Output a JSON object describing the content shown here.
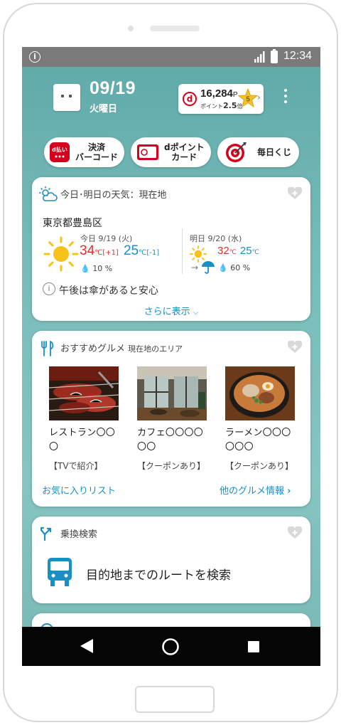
{
  "status": {
    "time": "12:34"
  },
  "header": {
    "date": "09/19",
    "weekday": "火曜日",
    "points": {
      "value": "16,284",
      "unit": "P",
      "rate_label": "ポイント",
      "rate": "2.5",
      "rate_unit": "倍",
      "rank": "5"
    }
  },
  "quick": [
    {
      "line1": "決済",
      "line2": "バーコード",
      "icon": "d-barai-icon"
    },
    {
      "line1": "dポイント",
      "line2": "カード",
      "icon": "dpoint-card-icon"
    },
    {
      "line1": "毎日くじ",
      "line2": "",
      "icon": "target-icon"
    }
  ],
  "weather": {
    "title": "今日･明日の天気：現在地",
    "city": "東京都豊島区",
    "today": {
      "label": "今日 9/19 (火)",
      "high": "34",
      "high_unit": "℃",
      "high_diff": "[+1]",
      "low": "25",
      "low_unit": "℃",
      "low_diff": "[-1]",
      "rain": "10 %"
    },
    "tomorrow": {
      "label": "明日 9/20 (水)",
      "high": "32",
      "high_unit": "℃",
      "low": "25",
      "low_unit": "℃",
      "rain": "60 %"
    },
    "advice": "午後は傘があると安心",
    "more": "さらに表示"
  },
  "gourmet": {
    "title": "おすすめグルメ",
    "subtitle": "現在地のエリア",
    "items": [
      {
        "name": "レストラン〇〇〇",
        "tag": "【TVで紹介】"
      },
      {
        "name": "カフェ〇〇〇〇〇〇",
        "tag": "【クーポンあり】"
      },
      {
        "name": "ラーメン〇〇〇〇〇〇",
        "tag": "【クーポンあり】"
      }
    ],
    "fav_link": "お気に入りリスト",
    "more_link": "他のグルメ情報"
  },
  "transit": {
    "title": "乗換検索",
    "action": "目的地までのルートを検索"
  },
  "colors": {
    "accent": "#1a8fc4",
    "temp_high": "#e0302a",
    "background_teal": "#6fb5b3",
    "docomo_red": "#d6001c"
  }
}
